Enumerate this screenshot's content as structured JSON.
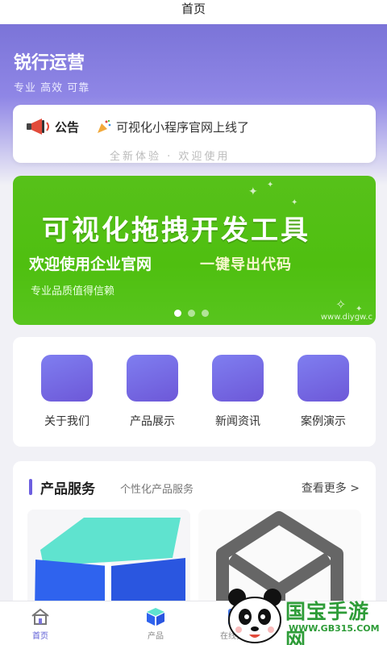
{
  "navbar": {
    "title": "首页"
  },
  "hero": {
    "brand": "锐行运营",
    "slogan": "专业 高效 可靠"
  },
  "notice": {
    "label": "公告",
    "text": "可视化小程序官网上线了",
    "ghost": "全新体验 · 欢迎使用"
  },
  "banner": {
    "title": "可视化拖拽开发工具",
    "subtitle_left": "欢迎使用企业官网",
    "subtitle_right": "一键导出代码",
    "tagline": "专业品质值得信赖",
    "url": "www.diygw.c",
    "slide_count": 3,
    "active_slide": 1
  },
  "quick_links": [
    {
      "label": "关于我们"
    },
    {
      "label": "产品展示"
    },
    {
      "label": "新闻资讯"
    },
    {
      "label": "案例演示"
    }
  ],
  "products": {
    "title": "产品服务",
    "subtitle": "个性化产品服务",
    "more": "查看更多 >"
  },
  "tabbar": [
    {
      "label": "首页",
      "icon": "home-icon",
      "active": true
    },
    {
      "label": "产品",
      "icon": "cube-icon",
      "active": false
    },
    {
      "label": "在线预约",
      "icon": "calendar-icon",
      "active": false
    }
  ],
  "watermark": {
    "text": "国宝手游网",
    "url": "WWW.GB315.COM"
  },
  "colors": {
    "accent": "#6d5fe0",
    "banner_green": "#4fbf10",
    "watermark_green": "#2e9c38"
  }
}
